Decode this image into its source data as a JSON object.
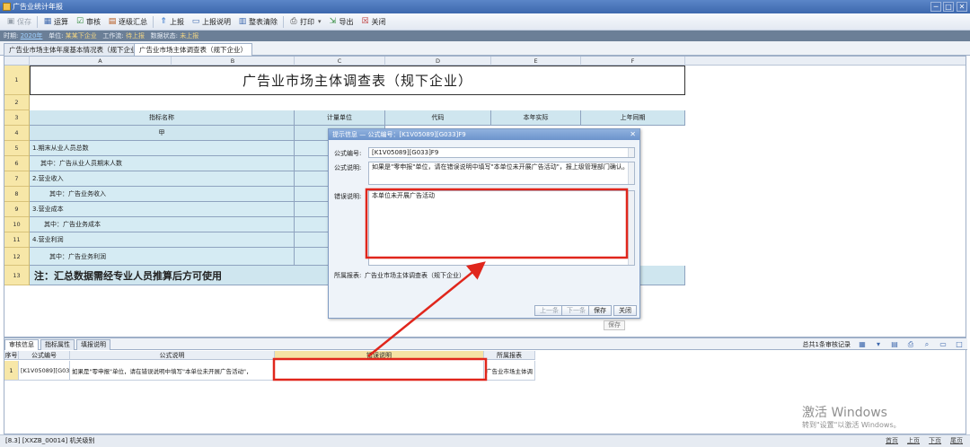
{
  "window": {
    "title": "广告业统计年报",
    "minimize_glyph": "─",
    "maximize_glyph": "□",
    "close_glyph": "✕"
  },
  "toolbar": {
    "items": [
      {
        "label": "保存",
        "icon": "save-icon",
        "glyph": "▣",
        "enabled": false
      },
      {
        "label": "运算",
        "icon": "calculator-icon",
        "glyph": "▦",
        "enabled": true
      },
      {
        "label": "审核",
        "icon": "check-icon",
        "glyph": "☑",
        "enabled": true
      },
      {
        "label": "逐级汇总",
        "icon": "summary-icon",
        "glyph": "▤",
        "enabled": true
      },
      {
        "label": "上报",
        "icon": "upload-icon",
        "glyph": "⇑",
        "enabled": true
      },
      {
        "label": "上报说明",
        "icon": "report-note-icon",
        "glyph": "▭",
        "enabled": true
      },
      {
        "label": "整表清除",
        "icon": "clear-table-icon",
        "glyph": "▥",
        "enabled": true
      },
      {
        "label": "打印",
        "icon": "print-icon",
        "glyph": "⎙",
        "enabled": true,
        "dropdown": "▾"
      },
      {
        "label": "导出",
        "icon": "export-icon",
        "glyph": "⇲",
        "enabled": true
      },
      {
        "label": "关闭",
        "icon": "close-doc-icon",
        "glyph": "☒",
        "enabled": true
      }
    ]
  },
  "infobar": {
    "period_label": "时期:",
    "period_value": "2020年",
    "unit_label": "单位:",
    "unit_value": "某某下企业",
    "workflow_label": "工作流:",
    "workflow_value": "待上报",
    "status_label": "数据状态:",
    "status_value": "未上报"
  },
  "tabs": [
    {
      "label": "广告业市场主体年度基本情况表（规下企业）",
      "active": false
    },
    {
      "label": "广告业市场主体调查表（规下企业）",
      "active": true
    }
  ],
  "sheet": {
    "columns": [
      "A",
      "B",
      "C",
      "D",
      "E",
      "F"
    ],
    "title": "广告业市场主体调查表（规下企业）",
    "header": {
      "name": "指标名称",
      "unit": "计量单位",
      "code": "代码",
      "current": "本年实际",
      "last": "上年同期"
    },
    "subheader": {
      "name": "甲"
    },
    "rows": [
      {
        "num": "1"
      },
      {
        "num": "2"
      },
      {
        "num": "3"
      },
      {
        "num": "4"
      },
      {
        "num": "5",
        "label": "1.期末从业人员总数"
      },
      {
        "num": "6",
        "label": "其中：广告从业人员期末人数"
      },
      {
        "num": "7",
        "label": "2.营业收入"
      },
      {
        "num": "8",
        "label": "其中：广告业务收入"
      },
      {
        "num": "9",
        "label": "3.营业成本"
      },
      {
        "num": "10",
        "label": "其中：广告业务成本"
      },
      {
        "num": "11",
        "label": "4.营业利润"
      },
      {
        "num": "12",
        "label": "其中：广告业务利润"
      },
      {
        "num": "13"
      }
    ],
    "note": "注：汇总数据需经专业人员推算后方可使用"
  },
  "dialog": {
    "title": "提示信息 — 公式编号：[K1V05089][G033]F9",
    "close_glyph": "✕",
    "formula_no_label": "公式编号:",
    "formula_no_value": "[K1V05089][G033]F9",
    "formula_desc_label": "公式说明:",
    "formula_desc_value": "如果是\"零申报\"单位，请在错误说明中填写\"本单位未开展广告活动\"，报上级管理部门确认。",
    "error_desc_label": "错误说明:",
    "error_desc_value": "本单位未开展广告活动",
    "report_label": "所属报表:",
    "report_value": "广告业市场主体调查表（规下企业）",
    "buttons": {
      "prev": "上一条",
      "next": "下一条",
      "save": "保存",
      "close": "关闭"
    },
    "tooltip": "保存"
  },
  "bottom": {
    "tabs": [
      {
        "label": "审核信息",
        "active": true
      },
      {
        "label": "指标属性",
        "active": false
      },
      {
        "label": "填报说明",
        "active": false
      }
    ],
    "record_count": "总共1条审核记录",
    "columns": [
      "序号",
      "公式编号",
      "公式说明",
      "错误说明",
      "所属报表"
    ],
    "rows": [
      {
        "seq": "1",
        "formula_no": "[K1V05089][G033]",
        "formula_desc": "如果是\"零申报\"单位，请在错误说明中填写\"本单位未开展广告活动\"，",
        "error_desc": "",
        "report": "广告业市场主体调"
      }
    ]
  },
  "statusbar": {
    "left": "[8.3]  [XXZB_00014] 机关级别",
    "right": [
      "首页",
      "上页",
      "下页",
      "尾页"
    ]
  },
  "watermark": {
    "line1": "激活 Windows",
    "line2": "转到\"设置\"以激活 Windows。"
  },
  "colors": {
    "header_cell": "#cfe6ef",
    "row_header": "#f7e7a8",
    "annotation": "#e0261c"
  }
}
